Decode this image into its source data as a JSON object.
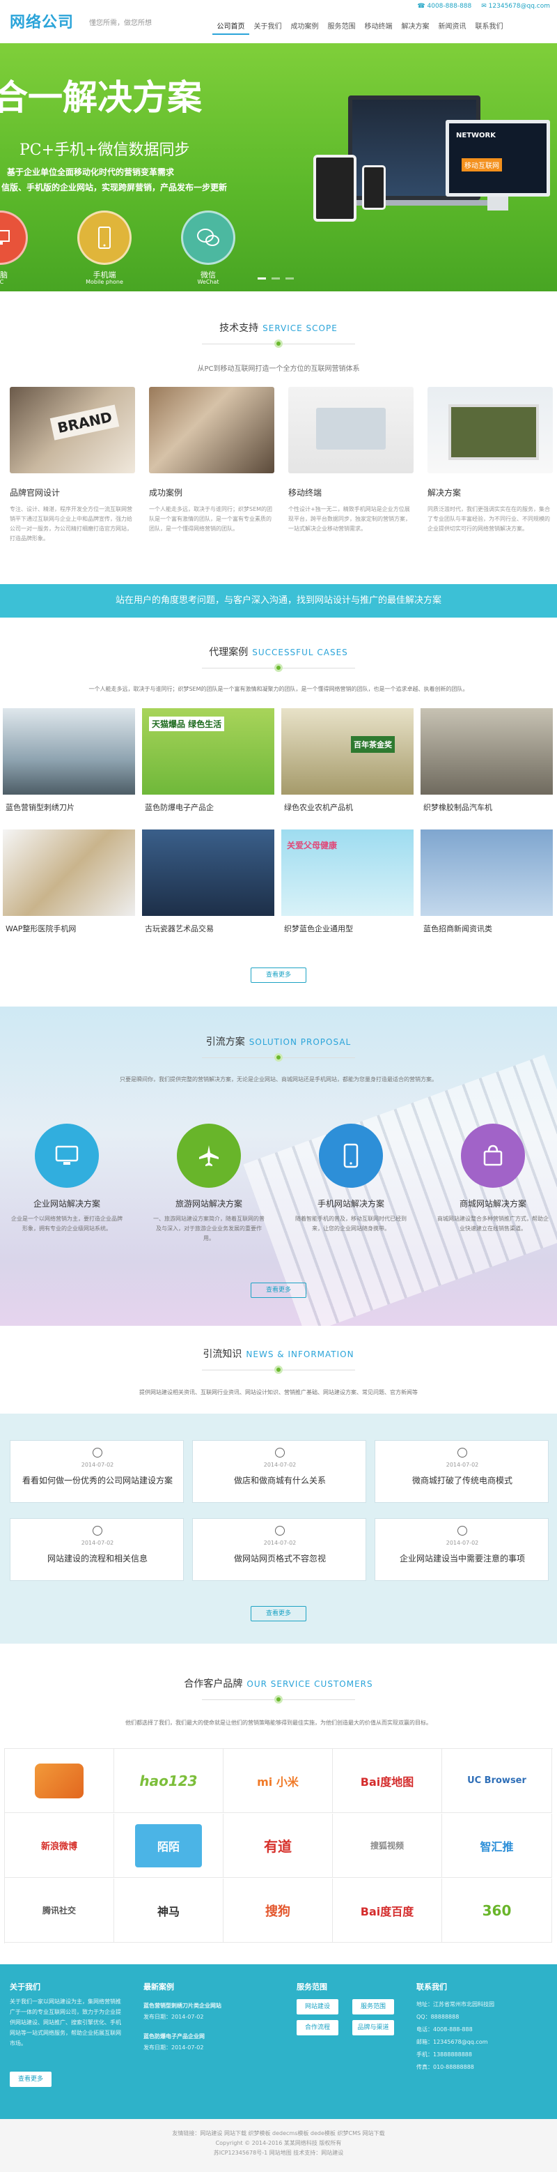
{
  "header": {
    "logo": "网络公司",
    "slogan": "懂您所需，做您所想",
    "phone": "4008-888-888",
    "email": "12345678@qq.com",
    "nav": [
      "公司首页",
      "关于我们",
      "成功案例",
      "服务范围",
      "移动终端",
      "解决方案",
      "新闻资讯",
      "联系我们"
    ]
  },
  "banner": {
    "title": "合一解决方案",
    "subtitle": "PC+手机+微信数据同步",
    "desc1": "基于企业单位全面移动化时代的营销变革需求",
    "desc2": "信版、手机版的企业网站，实现跨屏营销，产品发布一步更新",
    "items": [
      {
        "label": "电脑",
        "label_en": "PC"
      },
      {
        "label": "手机端",
        "label_en": "Mobile phone"
      },
      {
        "label": "微信",
        "label_en": "WeChat"
      }
    ],
    "screen_text": "NETWORK",
    "screen_text2": "移动互联网"
  },
  "tech": {
    "title": "技术支持",
    "title_en": "SERVICE SCOPE",
    "desc": "从PC到移动互联网打造一个全方位的互联网营销体系",
    "items": [
      {
        "title": "品牌官网设计",
        "text": "专注、设计、精湛，程序开发全方位一流互联网营销平下通过互联网与企业上中和品牌宣传，强力给公司一对一服务，为公司精打细磨打造官方网站，打造品牌形象。"
      },
      {
        "title": "成功案例",
        "text": "一个人能走多远，取决于与谁同行；织梦SEM的团队是一个富有激情的团队，是一个富有专业素质的团队，是一个懂得网络营销的团队。"
      },
      {
        "title": "移动终端",
        "text": "个性设计+独一无二，精致手机网站是企业方位展现平台，跨平台数据同步，独家定制的营销方案，一站式解决企业移动营销需求。"
      },
      {
        "title": "解决方案",
        "text": "同质泛滥时代，我们更强调实实在在的服务，集合了专业团队与丰富经验，为不同行业、不同规模的企业提供切实可行的网络营销解决方案。"
      }
    ]
  },
  "band_text": "站在用户的角度思考问题，与客户深入沟通，找到网站设计与推广的最佳解决方案",
  "cases": {
    "title": "代理案例",
    "title_en": "SUCCESSFUL CASES",
    "desc": "一个人能走多远，取决于与谁同行；织梦SEM的团队是一个富有激情和凝聚力的团队，是一个懂得网络营销的团队，也是一个追求卓越、执着创新的团队。",
    "items": [
      "蓝色营销型刺绣刀片",
      "蓝色防爆电子产品企",
      "绿色农业农机产品机",
      "织梦橡胶制品汽车机",
      "WAP整形医院手机网",
      "古玩瓷器艺术品交易",
      "织梦蓝色企业通用型",
      "蓝色招商新闻资讯类"
    ],
    "img_text": [
      "",
      "天猫爆品 绿色生活",
      "百年茶金奖",
      "",
      "",
      "",
      "关爱父母健康",
      ""
    ],
    "more": "查看更多"
  },
  "solutions": {
    "title": "引流方案",
    "title_en": "SOLUTION PROPOSAL",
    "desc": "只要是瞬间你，我们提供完整的营销解决方案，无论是企业网站、商城网站还是手机网站，都能为您量身打造最适合的营销方案。",
    "items": [
      {
        "title": "企业网站解决方案",
        "text": "企业是一个以网络营销为主，要打造企业品牌形象，拥有专业的企业级网站系统。"
      },
      {
        "title": "旅游网站解决方案",
        "text": "一、旅游网站建设方案简介，随着互联网的普及与深入，对于旅游企业业务发展的重要作用。"
      },
      {
        "title": "手机网站解决方案",
        "text": "随着智能手机的普及，移动互联网时代已经到来，让您的企业网站随身携带。"
      },
      {
        "title": "商城网站解决方案",
        "text": "商城网站建设整合多种营销推广方式，帮助企业快速建立在线销售渠道。"
      }
    ],
    "more": "查看更多"
  },
  "knowledge": {
    "title": "引流知识",
    "title_en": "NEWS & INFORMATION",
    "desc": "提供网站建设相关资讯、互联网行业资讯、网站设计知识、营销推广基础、网站建设方案、常见问题、官方新闻等",
    "items": [
      {
        "date": "2014-07-02",
        "title": "看看如何做一份优秀的公司网站建设方案"
      },
      {
        "date": "2014-07-02",
        "title": "做店和做商城有什么关系"
      },
      {
        "date": "2014-07-02",
        "title": "微商城打破了传统电商模式"
      },
      {
        "date": "2014-07-02",
        "title": "网站建设的流程和相关信息"
      },
      {
        "date": "2014-07-02",
        "title": "做网站网页格式不容忽视"
      },
      {
        "date": "2014-07-02",
        "title": "企业网站建设当中需要注意的事项"
      }
    ],
    "more": "查看更多"
  },
  "customers": {
    "title": "合作客户品牌",
    "title_en": "OUR SERVICE CUSTOMERS",
    "desc": "他们都选择了我们，我们最大的使命就是让他们的营销策略能够得到最佳实施，为他们创造最大的价值从而实现双赢的目标。",
    "logos": [
      "",
      "hao123",
      "mi 小米",
      "Bai度地图",
      "UC Browser",
      "新浪微博",
      "陌陌",
      "有道",
      "搜狐视频",
      "智汇推",
      "腾讯社交",
      "神马",
      "搜狗",
      "Bai度百度",
      "360"
    ]
  },
  "footer": {
    "about_title": "关于我们",
    "about_text": "关于我们一家以网站建设为主，集网络营销推广于一体的专业互联网公司，致力于为企业提供网站建设、网站推广、搜索引擎优化、手机网站等一站式网络服务，帮助企业拓展互联网市场。",
    "about_more": "查看更多",
    "news_title": "最新案例",
    "news": [
      {
        "title": "蓝色营销型刺绣刀片类企业网站",
        "meta": "发布日期：2014-07-02"
      },
      {
        "title": "蓝色防爆电子产品企业网",
        "meta": "发布日期：2014-07-02"
      }
    ],
    "service_title": "服务范围",
    "services": [
      "网站建设",
      "服务范围",
      "合作流程",
      "品牌与渠道"
    ],
    "contact_title": "联系我们",
    "contact": [
      "地址：江苏省常州市北园科技园",
      "QQ：88888888",
      "电话：4008-888-888",
      "邮箱：12345678@qq.com",
      "手机：13888888888",
      "传真：010-88888888"
    ]
  },
  "copyright": {
    "line1": "友情链接：网站建设  网站下载  织梦模板  dedecms模板  dede模板  织梦CMS  网站下载",
    "line2": "Copyright © 2014-2016 某某网络科技 版权所有",
    "line3": "苏ICP12345678号-1 网站地图 技术支持：网站建设"
  },
  "colors": {
    "green": "#6ab82e",
    "blue": "#2ba4d9",
    "teal": "#3cc0d6"
  }
}
